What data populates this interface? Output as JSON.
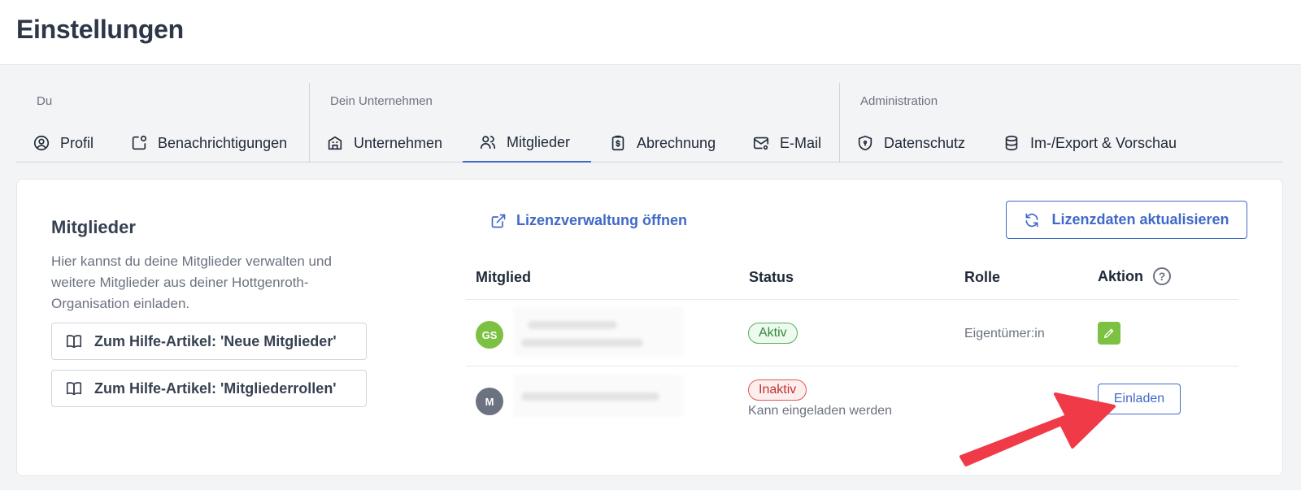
{
  "header": {
    "title": "Einstellungen"
  },
  "nav": {
    "groups": [
      {
        "label": "Du",
        "tabs": [
          {
            "label": "Profil"
          },
          {
            "label": "Benachrichtigungen"
          }
        ]
      },
      {
        "label": "Dein Unternehmen",
        "tabs": [
          {
            "label": "Unternehmen"
          },
          {
            "label": "Mitglieder"
          },
          {
            "label": "Abrechnung"
          },
          {
            "label": "E-Mail"
          }
        ]
      },
      {
        "label": "Administration",
        "tabs": [
          {
            "label": "Datenschutz"
          },
          {
            "label": "Im-/Export & Vorschau"
          }
        ]
      }
    ],
    "active_tab": "Mitglieder"
  },
  "members_section": {
    "title": "Mitglieder",
    "description": "Hier kannst du deine Mitglieder verwalten und weitere Mitglieder aus deiner Hottgenroth-Organisation einladen.",
    "help_links": [
      {
        "label": "Zum Hilfe-Artikel: 'Neue Mitglieder'"
      },
      {
        "label": "Zum Hilfe-Artikel: 'Mitgliederrollen'"
      }
    ]
  },
  "actions": {
    "open_license": "Lizenzverwaltung öffnen",
    "refresh_license": "Lizenzdaten aktualisieren"
  },
  "table": {
    "headers": {
      "member": "Mitglied",
      "status": "Status",
      "role": "Rolle",
      "action": "Aktion",
      "action_help": "?"
    },
    "rows": [
      {
        "initials": "GS",
        "avatar_color": "#7cc142",
        "status": "Aktiv",
        "role": "Eigentümer:in"
      },
      {
        "initials": "M",
        "avatar_color": "#6b7280",
        "status": "Inaktiv",
        "status_note": "Kann eingeladen werden",
        "action": "Einladen"
      }
    ]
  },
  "colors": {
    "accent": "#4169c8",
    "success": "#4fb35c",
    "danger": "#e05757",
    "annotation_arrow": "#f03a47"
  }
}
